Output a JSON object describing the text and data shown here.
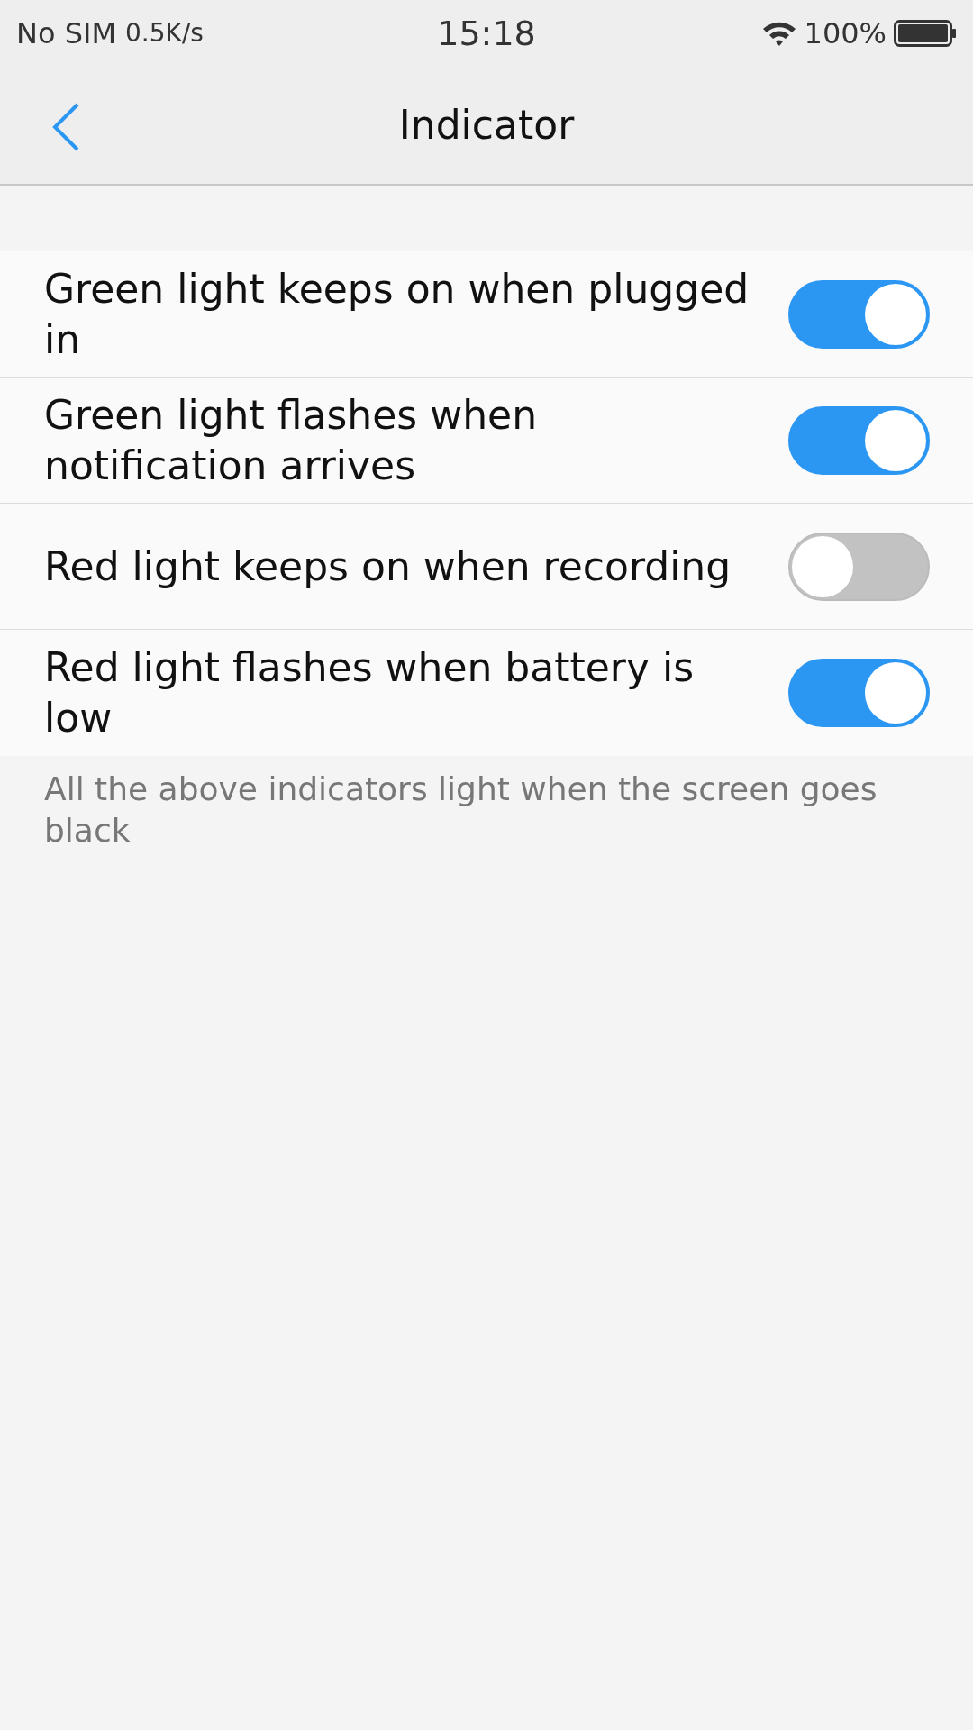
{
  "status_bar": {
    "carrier": "No SIM",
    "speed": "0.5K/s",
    "time": "15:18",
    "battery": "100%"
  },
  "header": {
    "title": "Indicator"
  },
  "settings": [
    {
      "label": "Green light keeps on when plugged in",
      "on": true
    },
    {
      "label": "Green light flashes when notification arrives",
      "on": true
    },
    {
      "label": "Red light keeps on when recording",
      "on": false
    },
    {
      "label": "Red light flashes when battery is low",
      "on": true
    }
  ],
  "footnote": "All the above indicators light when the screen goes black"
}
